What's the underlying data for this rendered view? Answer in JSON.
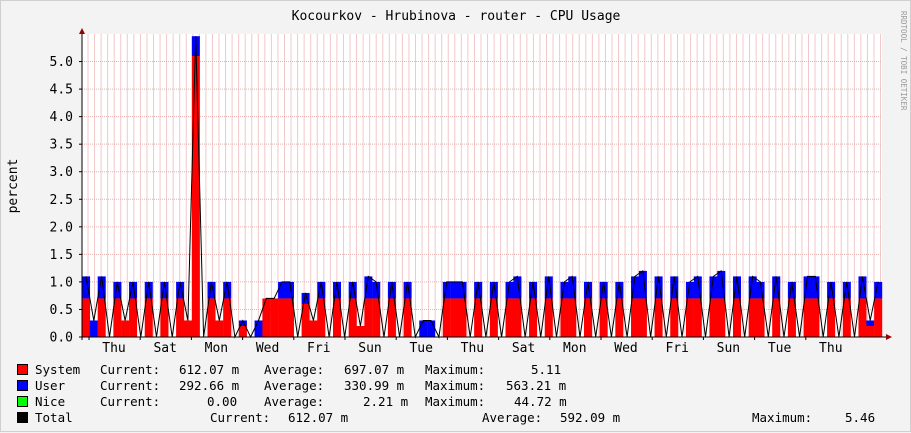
{
  "chart_data": {
    "type": "area",
    "title": "Kocourkov - Hrubinova - router - CPU Usage",
    "ylabel": "percent",
    "watermark": "RRDTOOL / TOBI OETIKER",
    "ylim": [
      0,
      5.5
    ],
    "yticks": [
      "0.0",
      "0.5",
      "1.0",
      "1.5",
      "2.0",
      "2.5",
      "3.0",
      "3.5",
      "4.0",
      "4.5",
      "5.0"
    ],
    "x_labels": [
      "Thu",
      "Sat",
      "Mon",
      "Wed",
      "Fri",
      "Sun",
      "Tue",
      "Thu",
      "Sat",
      "Mon",
      "Wed",
      "Fri",
      "Sun",
      "Tue",
      "Thu"
    ],
    "grid": true,
    "stacked": true,
    "series": [
      {
        "name": "System",
        "color": "#ff0000",
        "values": [
          0.7,
          0.0,
          0.7,
          0.0,
          0.7,
          0.3,
          0.7,
          0.0,
          0.7,
          0.0,
          0.7,
          0.0,
          0.7,
          0.3,
          5.1,
          0.0,
          0.7,
          0.3,
          0.7,
          0.0,
          0.2,
          0.0,
          0.0,
          0.7,
          0.7,
          0.7,
          0.7,
          0.0,
          0.6,
          0.3,
          0.7,
          0.0,
          0.7,
          0.0,
          0.7,
          0.2,
          0.7,
          0.7,
          0.0,
          0.7,
          0.0,
          0.7,
          0.0,
          0.0,
          0.0,
          0.0,
          0.7,
          0.7,
          0.7,
          0.0,
          0.7,
          0.0,
          0.7,
          0.0,
          0.7,
          0.7,
          0.0,
          0.7,
          0.0,
          0.7,
          0.0,
          0.7,
          0.7,
          0.0,
          0.7,
          0.0,
          0.7,
          0.0,
          0.7,
          0.0,
          0.7,
          0.7,
          0.0,
          0.7,
          0.0,
          0.7,
          0.0,
          0.7,
          0.7,
          0.0,
          0.7,
          0.7,
          0.0,
          0.7,
          0.0,
          0.7,
          0.7,
          0.0,
          0.7,
          0.0,
          0.7,
          0.0,
          0.7,
          0.7,
          0.0,
          0.7,
          0.0,
          0.7,
          0.0,
          0.7,
          0.2,
          0.7
        ]
      },
      {
        "name": "User",
        "color": "#0000ff",
        "values": [
          0.4,
          0.3,
          0.4,
          0.0,
          0.3,
          0.0,
          0.3,
          0.0,
          0.3,
          0.0,
          0.3,
          0.0,
          0.3,
          0.0,
          0.36,
          0.0,
          0.3,
          0.0,
          0.3,
          0.0,
          0.1,
          0.0,
          0.3,
          0.0,
          0.0,
          0.3,
          0.3,
          0.0,
          0.2,
          0.0,
          0.3,
          0.0,
          0.3,
          0.0,
          0.3,
          0.0,
          0.4,
          0.3,
          0.0,
          0.3,
          0.0,
          0.3,
          0.0,
          0.3,
          0.3,
          0.0,
          0.3,
          0.3,
          0.3,
          0.0,
          0.3,
          0.0,
          0.3,
          0.0,
          0.3,
          0.4,
          0.0,
          0.3,
          0.0,
          0.4,
          0.0,
          0.3,
          0.4,
          0.0,
          0.3,
          0.0,
          0.3,
          0.0,
          0.3,
          0.0,
          0.4,
          0.5,
          0.0,
          0.4,
          0.0,
          0.4,
          0.0,
          0.3,
          0.4,
          0.0,
          0.4,
          0.5,
          0.0,
          0.4,
          0.0,
          0.4,
          0.3,
          0.0,
          0.4,
          0.0,
          0.3,
          0.0,
          0.4,
          0.4,
          0.0,
          0.3,
          0.0,
          0.3,
          0.0,
          0.4,
          0.1,
          0.3
        ]
      },
      {
        "name": "Nice",
        "color": "#00ff00",
        "values": [
          0,
          0,
          0,
          0,
          0,
          0,
          0,
          0,
          0,
          0,
          0,
          0,
          0,
          0,
          0,
          0,
          0,
          0,
          0,
          0,
          0,
          0,
          0,
          0,
          0,
          0,
          0,
          0,
          0,
          0,
          0,
          0,
          0,
          0,
          0,
          0,
          0,
          0,
          0,
          0,
          0,
          0,
          0,
          0,
          0,
          0,
          0,
          0,
          0,
          0,
          0,
          0,
          0,
          0,
          0,
          0,
          0,
          0,
          0,
          0,
          0,
          0,
          0,
          0,
          0,
          0,
          0,
          0,
          0,
          0,
          0,
          0,
          0,
          0,
          0,
          0,
          0,
          0,
          0,
          0,
          0,
          0,
          0,
          0,
          0,
          0,
          0,
          0,
          0,
          0,
          0,
          0,
          0,
          0,
          0,
          0,
          0,
          0,
          0,
          0,
          0,
          0
        ]
      }
    ],
    "total_line_color": "#000000"
  },
  "legend": [
    {
      "name": "System",
      "color": "#ff0000",
      "current_label": "Current:",
      "current": "612.07 m",
      "average_label": "Average:",
      "average": "697.07 m",
      "maximum_label": "Maximum:",
      "maximum": "5.11"
    },
    {
      "name": "User",
      "color": "#0000ff",
      "current_label": "Current:",
      "current": "292.66 m",
      "average_label": "Average:",
      "average": "330.99 m",
      "maximum_label": "Maximum:",
      "maximum": "563.21 m"
    },
    {
      "name": "Nice",
      "color": "#00ff00",
      "current_label": "Current:",
      "current": "0.00",
      "average_label": "Average:",
      "average": "2.21 m",
      "maximum_label": "Maximum:",
      "maximum": "44.72 m"
    }
  ],
  "total": {
    "name": "Total",
    "color": "#000000",
    "current_label": "Current:",
    "current": "612.07 m",
    "average_label": "Average:",
    "average": "592.09 m",
    "maximum_label": "Maximum:",
    "maximum": "5.46"
  }
}
